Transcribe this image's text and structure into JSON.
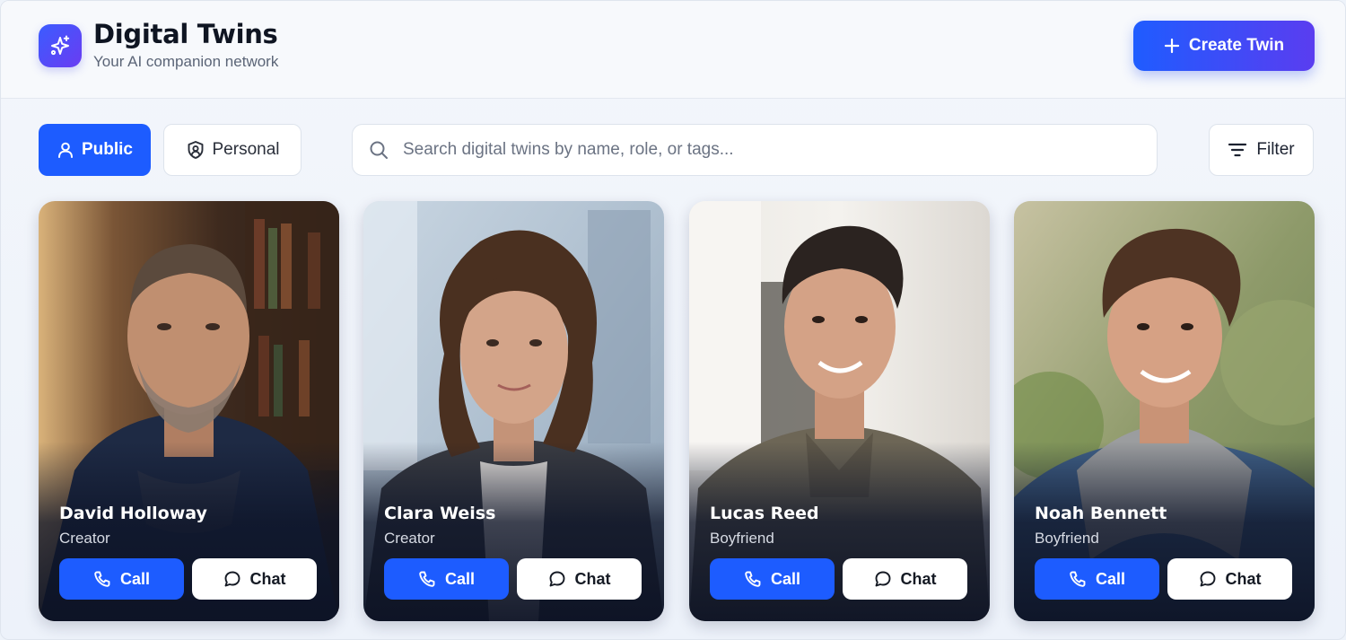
{
  "header": {
    "title": "Digital Twins",
    "subtitle": "Your AI companion network",
    "logo_icon": "sparkles-icon",
    "create_label": "Create Twin",
    "create_icon": "plus-icon"
  },
  "toolbar": {
    "public_label": "Public",
    "public_icon": "user-icon",
    "personal_label": "Personal",
    "personal_icon": "shield-user-icon",
    "active_tab": "Public",
    "search_placeholder": "Search digital twins by name, role, or tags...",
    "search_value": "",
    "filter_label": "Filter",
    "filter_icon": "filter-lines-icon"
  },
  "cards": [
    {
      "name": "David Holloway",
      "role": "Creator",
      "call_label": "Call",
      "chat_label": "Chat"
    },
    {
      "name": "Clara Weiss",
      "role": "Creator",
      "call_label": "Call",
      "chat_label": "Chat"
    },
    {
      "name": "Lucas Reed",
      "role": "Boyfriend",
      "call_label": "Call",
      "chat_label": "Chat"
    },
    {
      "name": "Noah Bennett",
      "role": "Boyfriend",
      "call_label": "Call",
      "chat_label": "Chat"
    }
  ],
  "colors": {
    "accent": "#1d5cff",
    "gradient_end": "#5a3df0"
  }
}
